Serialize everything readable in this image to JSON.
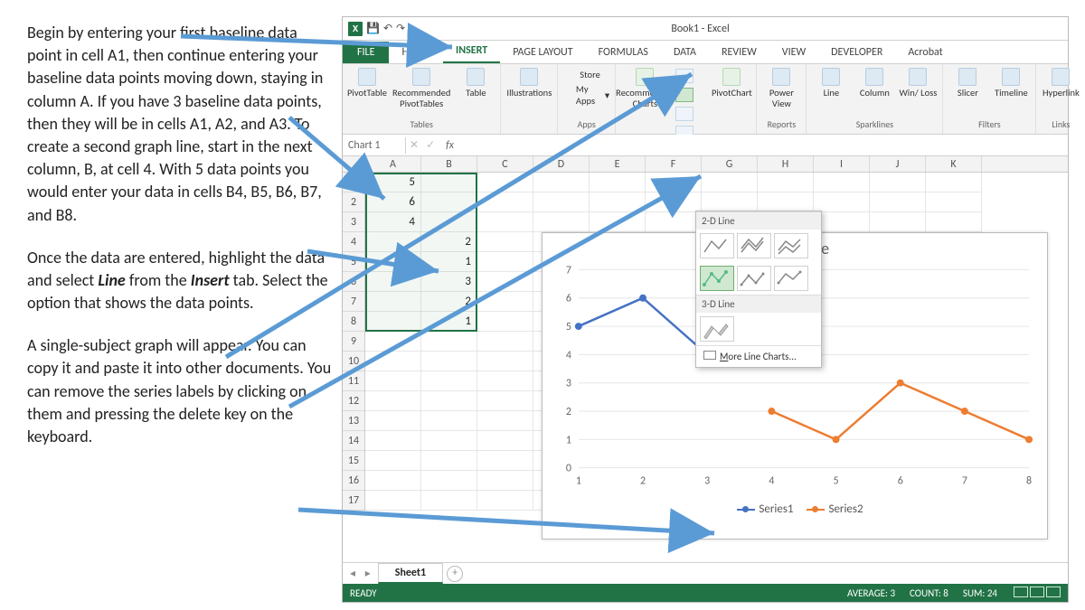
{
  "instructions": {
    "p1": "Begin by entering your first baseline data point in cell A1, then continue entering your baseline data points moving down, staying in column A.  If you have 3 baseline data points, then they will be in cells A1, A2, and A3. To create a second graph line, start in the next column, B, at cell 4.  With 5 data points you would enter your data in cells B4, B5, B6, B7, and B8.",
    "p2": "Once the data are entered, highlight the data and select Line from the Insert tab. Select the option that shows the data points.",
    "p3": "A single-subject graph will appear. You can copy it and paste it into other documents. You can remove the series labels by clicking on them and pressing the delete key on the keyboard."
  },
  "titlebar": {
    "title": "Book1 - Excel"
  },
  "tabs": {
    "file": "FILE",
    "items": [
      "HOME",
      "INSERT",
      "PAGE LAYOUT",
      "FORMULAS",
      "DATA",
      "REVIEW",
      "VIEW",
      "DEVELOPER",
      "Acrobat"
    ],
    "active": "INSERT"
  },
  "ribbon": {
    "tables": {
      "pivot": "PivotTable",
      "rec": "Recommended PivotTables",
      "table": "Table",
      "label": "Tables"
    },
    "ill": {
      "btn": "Illustrations"
    },
    "apps": {
      "store": "Store",
      "myapps": "My Apps",
      "label": "Apps"
    },
    "charts": {
      "rec": "Recommended Charts",
      "pivotchart": "PivotChart"
    },
    "reports": {
      "pv": "Power View",
      "label": "Reports"
    },
    "spark": {
      "line": "Line",
      "col": "Column",
      "wl": "Win/ Loss",
      "label": "Sparklines"
    },
    "filters": {
      "slicer": "Slicer",
      "tl": "Timeline",
      "label": "Filters"
    },
    "links": {
      "hl": "Hyperlink",
      "label": "Links"
    }
  },
  "dropdown": {
    "h1": "2-D Line",
    "h2": "3-D Line",
    "more": "More Line Charts..."
  },
  "namebox": "Chart 1",
  "columns": [
    "A",
    "B",
    "C",
    "D",
    "E",
    "F",
    "G",
    "H",
    "I",
    "J",
    "K"
  ],
  "rows": 17,
  "cell_data": {
    "A": {
      "1": 5,
      "2": 6,
      "3": 4
    },
    "B": {
      "4": 2,
      "5": 1,
      "6": 3,
      "7": 2,
      "8": 1
    }
  },
  "chart": {
    "title": "Chart Title",
    "legend": {
      "s1": "Series1",
      "s2": "Series2"
    }
  },
  "chart_data": {
    "type": "line",
    "x": [
      1,
      2,
      3,
      4,
      5,
      6,
      7,
      8
    ],
    "series": [
      {
        "name": "Series1",
        "values": [
          5,
          6,
          4,
          null,
          null,
          null,
          null,
          null
        ],
        "color": "#4472C4"
      },
      {
        "name": "Series2",
        "values": [
          null,
          null,
          null,
          2,
          1,
          3,
          2,
          1
        ],
        "color": "#ED7D31"
      }
    ],
    "ylim": [
      0,
      7
    ],
    "yticks": [
      0,
      1,
      2,
      3,
      4,
      5,
      6,
      7
    ],
    "title": "Chart Title"
  },
  "sheetbar": {
    "tab": "Sheet1"
  },
  "statusbar": {
    "ready": "READY",
    "avg": "AVERAGE: 3",
    "count": "COUNT: 8",
    "sum": "SUM: 24"
  }
}
